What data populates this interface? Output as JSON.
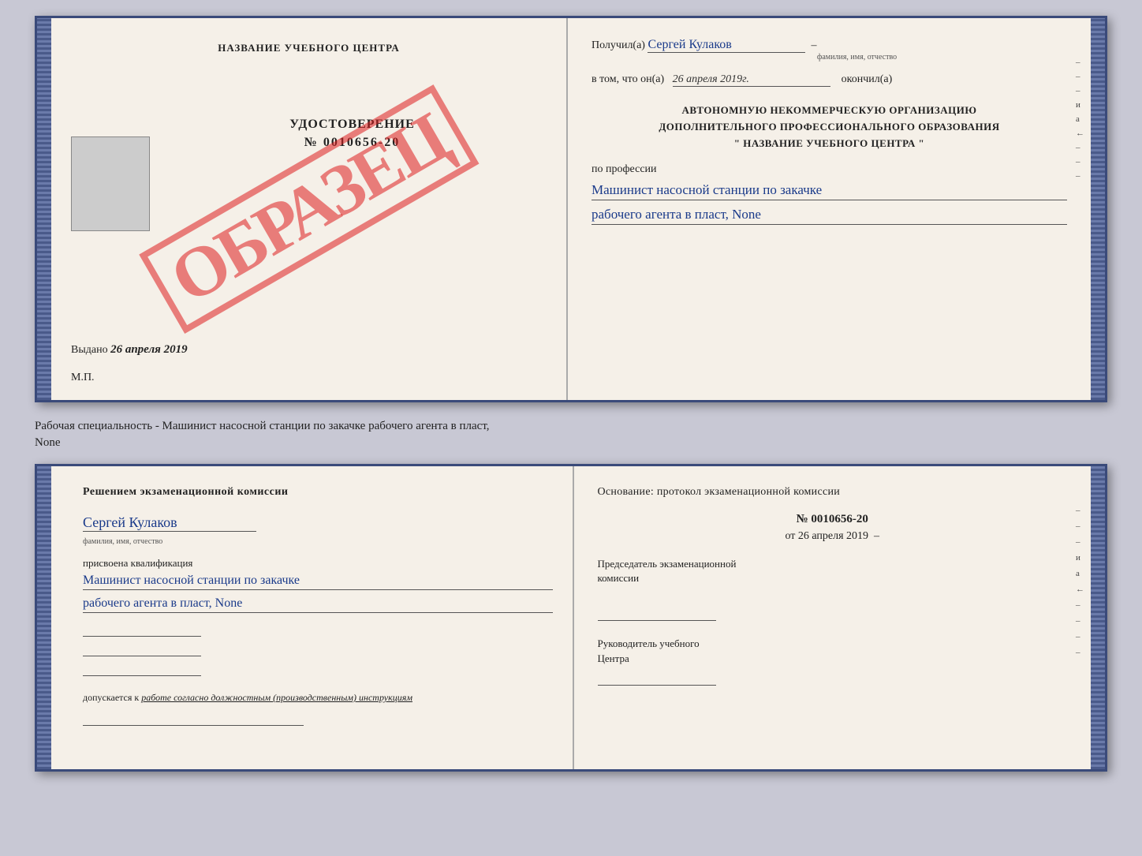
{
  "topDoc": {
    "leftPage": {
      "schoolName": "НАЗВАНИЕ УЧЕБНОГО ЦЕНТРА",
      "certTitle": "УДОСТОВЕРЕНИЕ",
      "certNumber": "№ 0010656-20",
      "issuedLabel": "Выдано",
      "issuedDate": "26 апреля 2019",
      "mpLabel": "М.П.",
      "watermark": "ОБРАЗЕЦ"
    },
    "rightPage": {
      "receivedLabel": "Получил(а)",
      "recipientName": "Сергей Кулаков",
      "fieldHint": "фамилия, имя, отчество",
      "dateLabel": "в том, что он(а)",
      "dateValue": "26 апреля 2019г.",
      "finishedLabel": "окончил(а)",
      "orgLine1": "АВТОНОМНУЮ НЕКОММЕРЧЕСКУЮ ОРГАНИЗАЦИЮ",
      "orgLine2": "ДОПОЛНИТЕЛЬНОГО ПРОФЕССИОНАЛЬНОГО ОБРАЗОВАНИЯ",
      "orgLine3": "\"   НАЗВАНИЕ УЧЕБНОГО ЦЕНТРА   \"",
      "professionLabel": "по профессии",
      "profession1": "Машинист насосной станции по закачке",
      "profession2": "рабочего агента в пласт, None",
      "sideMarks": [
        "-",
        "-",
        "-",
        "и",
        "а",
        "←",
        "-",
        "-",
        "-"
      ]
    }
  },
  "middleText": {
    "line1": "Рабочая специальность - Машинист насосной станции по закачке рабочего агента в пласт,",
    "line2": "None"
  },
  "bottomDoc": {
    "leftPage": {
      "commissionTitle": "Решением  экзаменационной  комиссии",
      "personName": "Сергей Кулаков",
      "fieldHint": "фамилия, имя, отчество",
      "qualificationLabel": "присвоена квалификация",
      "qualification1": "Машинист насосной станции по закачке",
      "qualification2": "рабочего агента в пласт, None",
      "allowedLabel": "допускается к",
      "allowedValue": "работе согласно должностным (производственным) инструкциям"
    },
    "rightPage": {
      "basisLabel": "Основание:  протокол экзаменационной  комиссии",
      "protocolNumber": "№  0010656-20",
      "protocolDateLabel": "от",
      "protocolDate": "26 апреля 2019",
      "chairmanLabel1": "Председатель экзаменационной",
      "chairmanLabel2": "комиссии",
      "directorLabel1": "Руководитель учебного",
      "directorLabel2": "Центра",
      "sideMarks": [
        "-",
        "-",
        "-",
        "и",
        "а",
        "←",
        "-",
        "-",
        "-",
        "-"
      ]
    }
  }
}
